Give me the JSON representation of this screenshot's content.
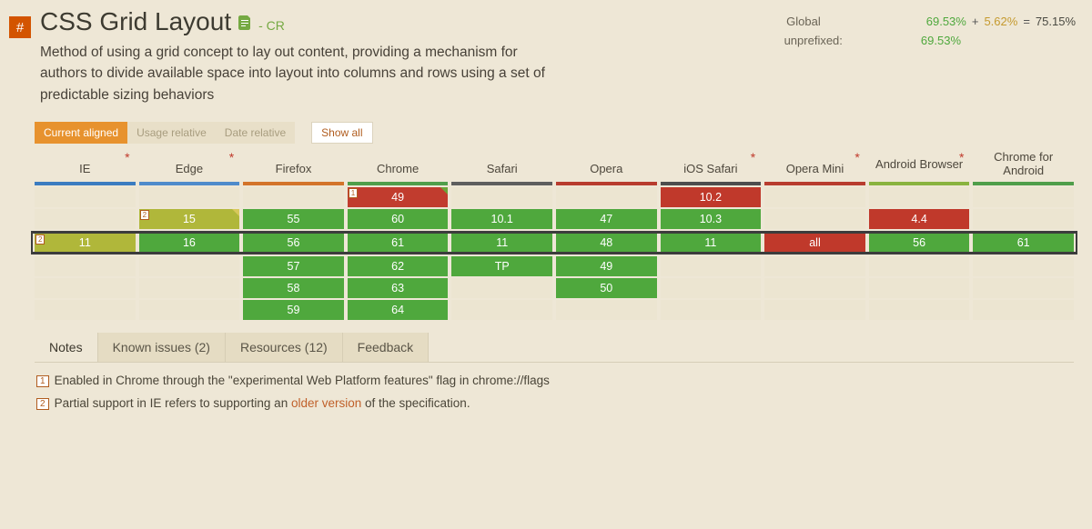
{
  "feature": {
    "hash": "#",
    "title": "CSS Grid Layout",
    "status": "- CR",
    "description": "Method of using a grid concept to lay out content, providing a mechanism for authors to divide available space into layout into columns and rows using a set of predictable sizing behaviors"
  },
  "stats": {
    "global_label": "Global",
    "supported": "69.53%",
    "plus": "+",
    "partial": "5.62%",
    "equals": "=",
    "total": "75.15%",
    "unprefixed_label": "unprefixed:",
    "unprefixed_value": "69.53%"
  },
  "controls": {
    "current_aligned": "Current aligned",
    "usage_relative": "Usage relative",
    "date_relative": "Date relative",
    "show_all": "Show all"
  },
  "browsers": [
    {
      "name": "IE",
      "asterisk": true
    },
    {
      "name": "Edge",
      "asterisk": true
    },
    {
      "name": "Firefox",
      "asterisk": false
    },
    {
      "name": "Chrome",
      "asterisk": false
    },
    {
      "name": "Safari",
      "asterisk": false
    },
    {
      "name": "Opera",
      "asterisk": false
    },
    {
      "name": "iOS Safari",
      "asterisk": true
    },
    {
      "name": "Opera Mini",
      "asterisk": true
    },
    {
      "name": "Android Browser",
      "asterisk": true
    },
    {
      "name": "Chrome for Android",
      "asterisk": false
    }
  ],
  "rows": {
    "r0": {
      "chrome": {
        "v": "49",
        "note": "1"
      },
      "ios": {
        "v": "10.2"
      }
    },
    "r1": {
      "edge": {
        "v": "15",
        "note": "2"
      },
      "firefox": {
        "v": "55"
      },
      "chrome": {
        "v": "60"
      },
      "safari": {
        "v": "10.1"
      },
      "opera": {
        "v": "47"
      },
      "ios": {
        "v": "10.3"
      },
      "android": {
        "v": "4.4"
      }
    },
    "current": {
      "ie": {
        "v": "11",
        "note": "2"
      },
      "edge": {
        "v": "16"
      },
      "firefox": {
        "v": "56"
      },
      "chrome": {
        "v": "61"
      },
      "safari": {
        "v": "11"
      },
      "opera": {
        "v": "48"
      },
      "ios": {
        "v": "11"
      },
      "omini": {
        "v": "all"
      },
      "android": {
        "v": "56"
      },
      "ca": {
        "v": "61"
      }
    },
    "f1": {
      "firefox": {
        "v": "57"
      },
      "chrome": {
        "v": "62"
      },
      "safari": {
        "v": "TP"
      },
      "opera": {
        "v": "49"
      }
    },
    "f2": {
      "firefox": {
        "v": "58"
      },
      "chrome": {
        "v": "63"
      },
      "opera": {
        "v": "50"
      }
    },
    "f3": {
      "firefox": {
        "v": "59"
      },
      "chrome": {
        "v": "64"
      }
    }
  },
  "tabs": {
    "notes": "Notes",
    "known_issues": "Known issues (2)",
    "resources": "Resources (12)",
    "feedback": "Feedback"
  },
  "notes": {
    "n1": "Enabled in Chrome through the \"experimental Web Platform features\" flag in chrome://flags",
    "n2_a": "Partial support in IE refers to supporting an ",
    "n2_link": "older version",
    "n2_b": " of the specification."
  }
}
